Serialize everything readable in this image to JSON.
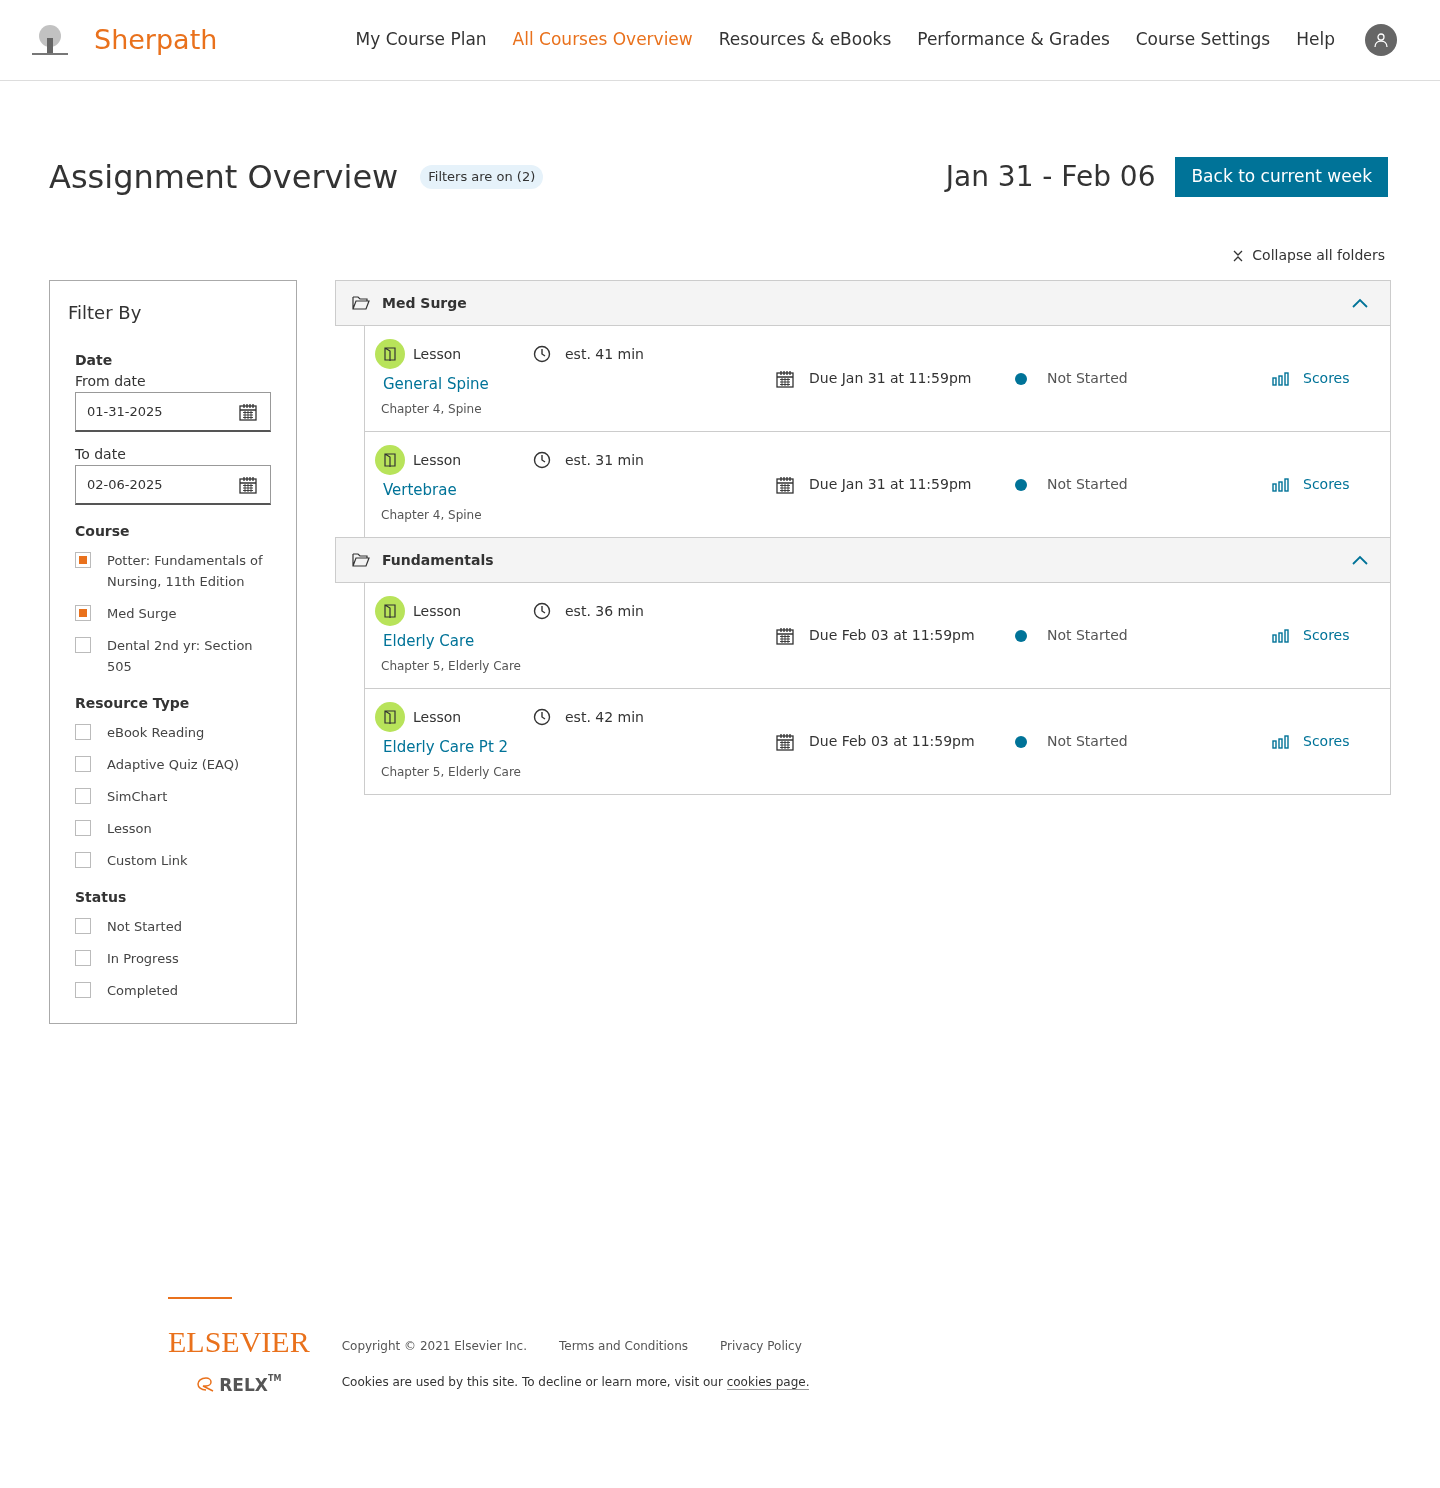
{
  "brand": {
    "name": "Sherpath"
  },
  "nav": [
    {
      "label": "My Course Plan",
      "selected": false
    },
    {
      "label": "All Courses Overview",
      "selected": true
    },
    {
      "label": "Resources & eBooks",
      "selected": false
    },
    {
      "label": "Performance & Grades",
      "selected": false
    },
    {
      "label": "Course Settings",
      "selected": false
    },
    {
      "label": "Help",
      "selected": false
    }
  ],
  "page": {
    "title": "Assignment Overview",
    "filter_badge": "Filters are on (2)",
    "week": "Jan 31 - Feb 06",
    "back_button": "Back to current week",
    "collapse_all": "Collapse all folders"
  },
  "filters": {
    "title": "Filter By",
    "date_heading": "Date",
    "from_label": "From date",
    "from_value": "01-31-2025",
    "to_label": "To date",
    "to_value": "02-06-2025",
    "groups": [
      {
        "heading": "Course",
        "options": [
          {
            "label": "Potter: Fundamentals of Nursing, 11th Edition",
            "checked": true
          },
          {
            "label": "Med Surge",
            "checked": true
          },
          {
            "label": "Dental 2nd yr: Section 505",
            "checked": false
          }
        ]
      },
      {
        "heading": "Resource Type",
        "options": [
          {
            "label": "eBook Reading",
            "checked": false
          },
          {
            "label": "Adaptive Quiz (EAQ)",
            "checked": false
          },
          {
            "label": "SimChart",
            "checked": false
          },
          {
            "label": "Lesson",
            "checked": false
          },
          {
            "label": "Custom Link",
            "checked": false
          }
        ]
      },
      {
        "heading": "Status",
        "options": [
          {
            "label": "Not Started",
            "checked": false
          },
          {
            "label": "In Progress",
            "checked": false
          },
          {
            "label": "Completed",
            "checked": false
          }
        ]
      }
    ]
  },
  "folders": [
    {
      "name": "Med Surge",
      "expanded": true,
      "items": [
        {
          "type": "Lesson",
          "estimate": "est. 41 min",
          "title": "General Spine",
          "chapter": "Chapter 4, Spine",
          "due": "Due Jan 31 at 11:59pm",
          "status": "Not Started",
          "color": "#007398",
          "scores": "Scores"
        },
        {
          "type": "Lesson",
          "estimate": "est. 31 min",
          "title": "Vertebrae",
          "chapter": "Chapter 4, Spine",
          "due": "Due Jan 31 at 11:59pm",
          "status": "Not Started",
          "color": "#007398",
          "scores": "Scores"
        }
      ]
    },
    {
      "name": "Fundamentals",
      "expanded": true,
      "items": [
        {
          "type": "Lesson",
          "estimate": "est. 36 min",
          "title": "Elderly Care",
          "chapter": "Chapter 5, Elderly Care",
          "due": "Due Feb 03 at 11:59pm",
          "status": "Not Started",
          "color": "#007398",
          "scores": "Scores"
        },
        {
          "type": "Lesson",
          "estimate": "est. 42 min",
          "title": "Elderly Care Pt 2",
          "chapter": "Chapter 5, Elderly Care",
          "due": "Due Feb 03 at 11:59pm",
          "status": "Not Started",
          "color": "#007398",
          "scores": "Scores"
        }
      ]
    }
  ],
  "footer": {
    "logo": "ELSEVIER",
    "relx": "RELX",
    "tm": "TM",
    "copyright": "Copyright © 2021 Elsevier Inc.",
    "links": [
      "Terms and Conditions",
      "Privacy Policy"
    ],
    "cookies_text": "Cookies are used by this site. To decline or learn more, visit our",
    "cookies_link": "cookies page."
  }
}
